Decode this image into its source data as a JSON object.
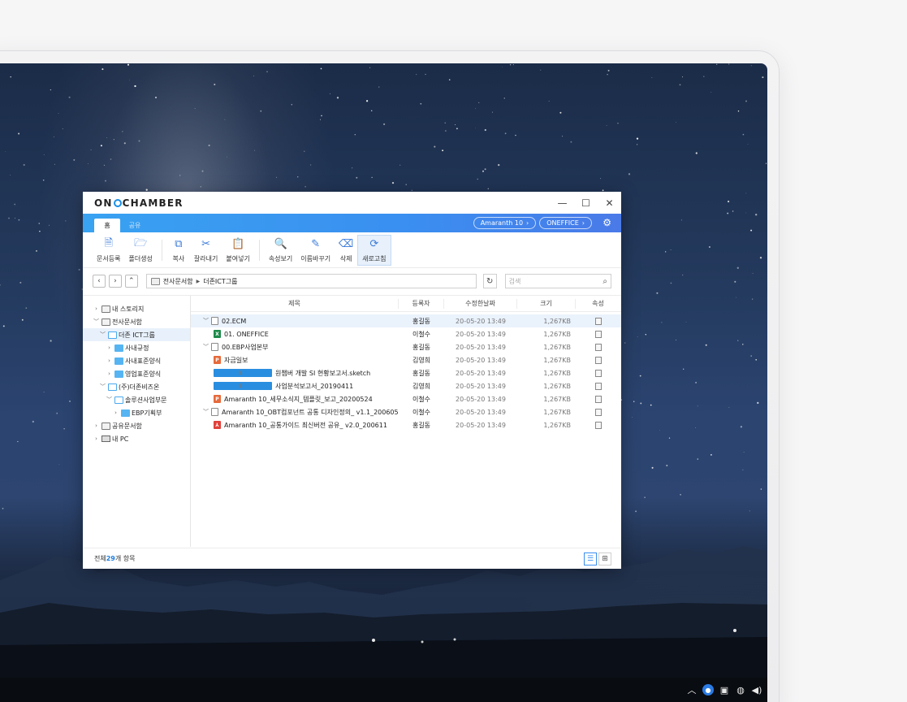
{
  "app": {
    "logo_pre": "ON",
    "logo_post": "CHAMBER"
  },
  "window_controls": {
    "minimize": "—",
    "maximize": "☐",
    "close": "✕"
  },
  "ribbon": {
    "tabs": [
      {
        "label": "홈",
        "active": true
      },
      {
        "label": "공유",
        "active": false
      }
    ],
    "pills": [
      {
        "label": "Amaranth 10"
      },
      {
        "label": "ONEFFICE"
      }
    ]
  },
  "toolbar": {
    "groups": [
      [
        {
          "label": "문서등록",
          "icon": "document-add-icon"
        },
        {
          "label": "폴더생성",
          "icon": "folder-add-icon"
        }
      ],
      [
        {
          "label": "복사",
          "icon": "copy-icon"
        },
        {
          "label": "잘라내기",
          "icon": "scissors-icon"
        },
        {
          "label": "붙여넣기",
          "icon": "paste-icon"
        }
      ],
      [
        {
          "label": "속성보기",
          "icon": "properties-icon"
        },
        {
          "label": "이름바꾸기",
          "icon": "rename-icon"
        },
        {
          "label": "삭제",
          "icon": "eraser-icon"
        },
        {
          "label": "새로고침",
          "icon": "refresh-icon",
          "selected": true
        }
      ]
    ]
  },
  "address": {
    "path_root": "전사문서함",
    "path_child": "더존ICT그룹",
    "search_placeholder": "검색"
  },
  "tree": [
    {
      "label": "내 스토리지",
      "level": 0,
      "chevron": "right",
      "icon": "drive"
    },
    {
      "label": "전사문서함",
      "level": 0,
      "chevron": "down",
      "icon": "drive"
    },
    {
      "label": "더존 ICT그룹",
      "level": 1,
      "chevron": "down",
      "icon": "folder-open",
      "selected": true
    },
    {
      "label": "사내규정",
      "level": 2,
      "chevron": "right",
      "icon": "folder"
    },
    {
      "label": "사내표준양식",
      "level": 2,
      "chevron": "right",
      "icon": "folder"
    },
    {
      "label": "영업표준양식",
      "level": 2,
      "chevron": "right",
      "icon": "folder"
    },
    {
      "label": "(주)더존비즈온",
      "level": 1,
      "chevron": "down",
      "icon": "folder-open"
    },
    {
      "label": "솔루션사업부문",
      "level": 2,
      "chevron": "down",
      "icon": "folder-open"
    },
    {
      "label": "EBP기획부",
      "level": 3,
      "chevron": "right",
      "icon": "folder"
    },
    {
      "label": "공유문서함",
      "level": 0,
      "chevron": "right",
      "icon": "drive"
    },
    {
      "label": "내 PC",
      "level": 0,
      "chevron": "right",
      "icon": "pc"
    }
  ],
  "list": {
    "headers": {
      "title": "제목",
      "user": "등록자",
      "date": "수정한날짜",
      "size": "크기",
      "attr": "속성"
    },
    "rows": [
      {
        "title": "02.ECM",
        "type": "folder",
        "indent": 0,
        "expanded": true,
        "user": "홍길동",
        "date": "20-05-20 13:49",
        "size": "1,267KB",
        "selected": true
      },
      {
        "title": "01. ONEFFICE",
        "type": "x",
        "indent": 1,
        "user": "이철수",
        "date": "20-05-20 13:49",
        "size": "1,267KB"
      },
      {
        "title": "00.EBP사업본부",
        "type": "folder",
        "indent": 0,
        "expanded": true,
        "user": "홍길동",
        "date": "20-05-20 13:49",
        "size": "1,267KB"
      },
      {
        "title": "자금일보",
        "type": "p",
        "indent": 1,
        "user": "김영희",
        "date": "20-05-20 13:49",
        "size": "1,267KB"
      },
      {
        "title": "원챔버 개발 SI 현황보고서.sketch",
        "type": "s",
        "indent": 1,
        "user": "홍길동",
        "date": "20-05-20 13:49",
        "size": "1,267KB"
      },
      {
        "title": "사업분석보고서_20190411",
        "type": "s",
        "indent": 1,
        "user": "김영희",
        "date": "20-05-20 13:49",
        "size": "1,267KB"
      },
      {
        "title": "Amaranth 10_세무소식지_템플릿_보고_20200524",
        "type": "p",
        "indent": 1,
        "user": "이철수",
        "date": "20-05-20 13:49",
        "size": "1,267KB"
      },
      {
        "title": "Amaranth 10_OBT컴포넌트 공통 디자인정의_ v1.1_200605",
        "type": "folder",
        "indent": 0,
        "expanded": true,
        "user": "이철수",
        "date": "20-05-20 13:49",
        "size": "1,267KB"
      },
      {
        "title": "Amaranth 10_공통가이드 최신버전 공유_ v2.0_200611",
        "type": "pdf",
        "indent": 1,
        "user": "홍길동",
        "date": "20-05-20 13:49",
        "size": "1,267KB"
      }
    ]
  },
  "status": {
    "prefix": "전체 ",
    "count": "29",
    "suffix": "개 항목"
  },
  "colors": {
    "accent": "#3a8ff0",
    "ribbon_start": "#39a2f1",
    "count": "#1c7fe0"
  }
}
